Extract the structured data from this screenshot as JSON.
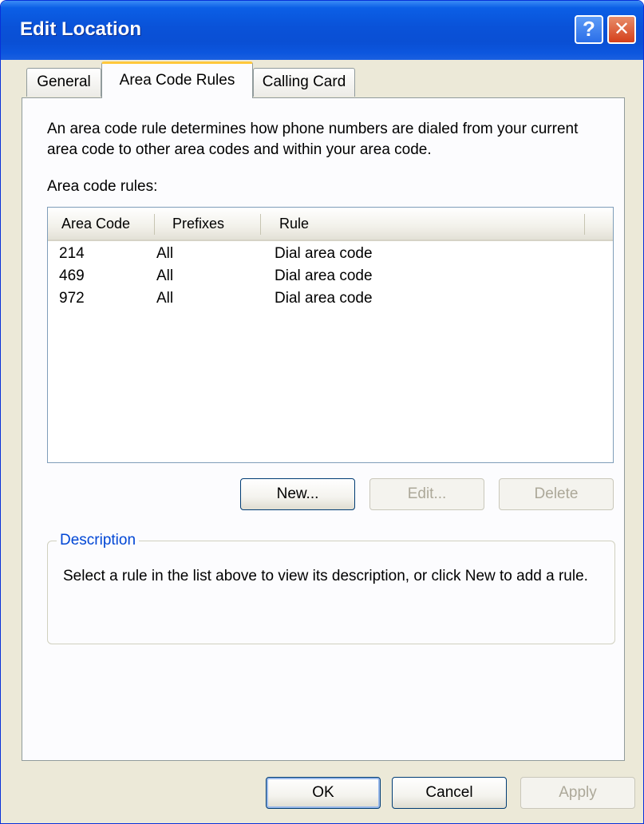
{
  "window": {
    "title": "Edit Location",
    "help_glyph": "?",
    "close_glyph": "✕"
  },
  "tabs": [
    {
      "label": "General",
      "selected": false
    },
    {
      "label": "Area Code Rules",
      "selected": true
    },
    {
      "label": "Calling Card",
      "selected": false
    }
  ],
  "area_code_rules": {
    "intro": "An area code rule determines how phone numbers are dialed from your current area code to other area codes and within your area code.",
    "list_label": "Area code rules:",
    "columns": [
      "Area Code",
      "Prefixes",
      "Rule"
    ],
    "rows": [
      [
        "214",
        "All",
        "Dial area code"
      ],
      [
        "469",
        "All",
        "Dial area code"
      ],
      [
        "972",
        "All",
        "Dial area code"
      ]
    ],
    "buttons": {
      "new": "New...",
      "edit": "Edit...",
      "delete": "Delete"
    },
    "description": {
      "title": "Description",
      "text": "Select a rule in the list above to view its description, or click New to add a rule."
    }
  },
  "footer": {
    "ok": "OK",
    "cancel": "Cancel",
    "apply": "Apply"
  },
  "colors": {
    "title_bar": "#0a52d8",
    "selected_tab_accent": "#ffc83c",
    "group_title": "#0046d5",
    "disabled_text": "#aca899"
  }
}
